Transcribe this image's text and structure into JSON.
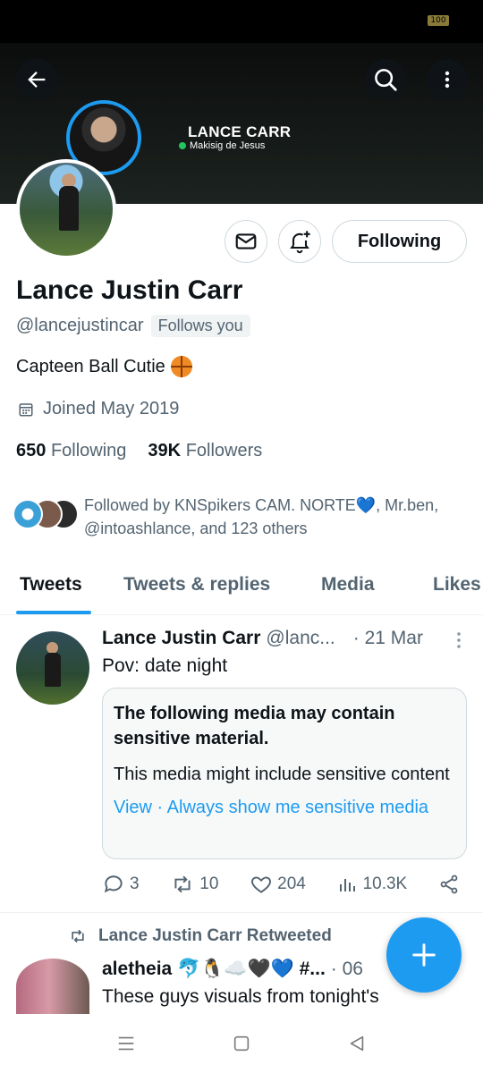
{
  "status_bar": {
    "battery": "100"
  },
  "banner": {
    "title": "LANCE CARR",
    "subtitle": "Makisig de Jesus"
  },
  "buttons": {
    "following": "Following"
  },
  "profile": {
    "display_name": "Lance Justin Carr",
    "handle": "@lancejustincar",
    "follows_you": "Follows you",
    "bio": "Capteen Ball Cutie",
    "joined": "Joined May 2019",
    "following_count": "650",
    "following_label": "Following",
    "followers_count": "39K",
    "followers_label": "Followers",
    "followed_by": "Followed by KNSpikers CAM. NORTE💙, Mr.ben, @intoashlance, and 123 others"
  },
  "tabs": [
    "Tweets",
    "Tweets & replies",
    "Media",
    "Likes"
  ],
  "tweet": {
    "name": "Lance Justin Carr",
    "handle": "@lanc...",
    "date": "· 21 Mar",
    "text": "Pov: date night",
    "sensitive_title": "The following media may contain sensitive material.",
    "sensitive_body": "This media might include sensitive content",
    "view_link": "View",
    "separator": " · ",
    "always_link": "Always show me sensitive media",
    "replies": "3",
    "retweets": "10",
    "likes": "204",
    "views": "10.3K"
  },
  "second_tweet": {
    "retweeted_by": "Lance Justin Carr Retweeted",
    "name": "aletheia 🐬🐧☁️🖤💙 #...",
    "date": "· 06",
    "text": "These guys visuals from tonight's"
  },
  "colors": {
    "accent": "#1d9bf0",
    "text_primary": "#0f1419",
    "text_secondary": "#536471",
    "online": "#22c55e"
  }
}
